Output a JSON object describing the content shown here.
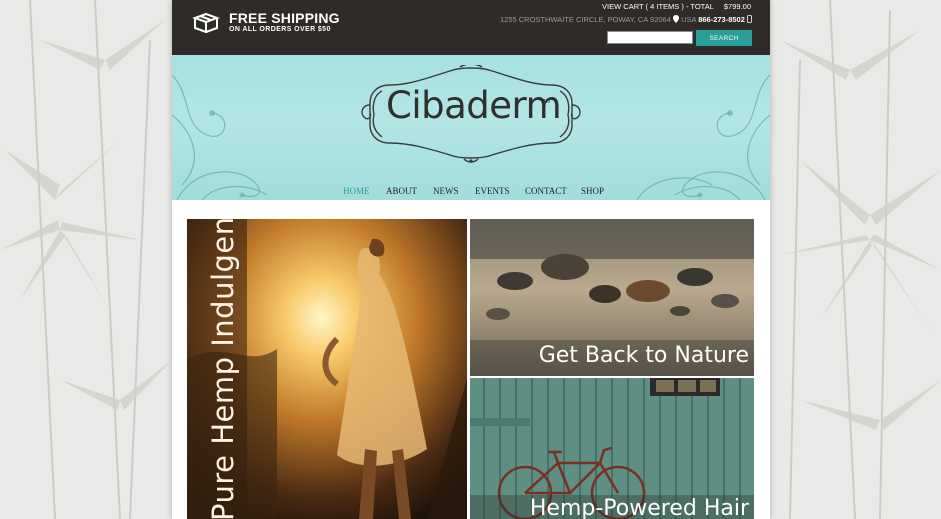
{
  "colors": {
    "accent": "#2a9f9a",
    "topbar": "#2e2b28",
    "banner": "#a6e1e0"
  },
  "shipping": {
    "icon": "box-icon",
    "title": "FREE SHIPPING",
    "subtitle": "ON ALL ORDERS OVER $50"
  },
  "cart": {
    "label": "VIEW CART ( 4 ITEMS ) - TOTAL",
    "total": "$799.00"
  },
  "contact": {
    "address": "1255 CROSTHWAITE CIRCLE, POWAY, CA 92064",
    "location_icon": "map-pin-icon",
    "country": "USA",
    "phone": "866-273-8502",
    "phone_icon": "phone-icon"
  },
  "search": {
    "value": "",
    "button_label": "SEARCH"
  },
  "logo": {
    "text": "Cibaderm",
    "tm": "TM"
  },
  "nav": {
    "items": [
      {
        "label": "HOME",
        "active": true
      },
      {
        "label": "ABOUT",
        "active": false
      },
      {
        "label": "NEWS",
        "active": false
      },
      {
        "label": "EVENTS",
        "active": false
      },
      {
        "label": "CONTACT",
        "active": false
      },
      {
        "label": "SHOP",
        "active": false
      }
    ]
  },
  "tiles": {
    "left_caption": "Pure Hemp Indulgence",
    "top_right_caption": "Get Back to Nature",
    "bottom_right_caption": "Hemp-Powered Hair"
  }
}
